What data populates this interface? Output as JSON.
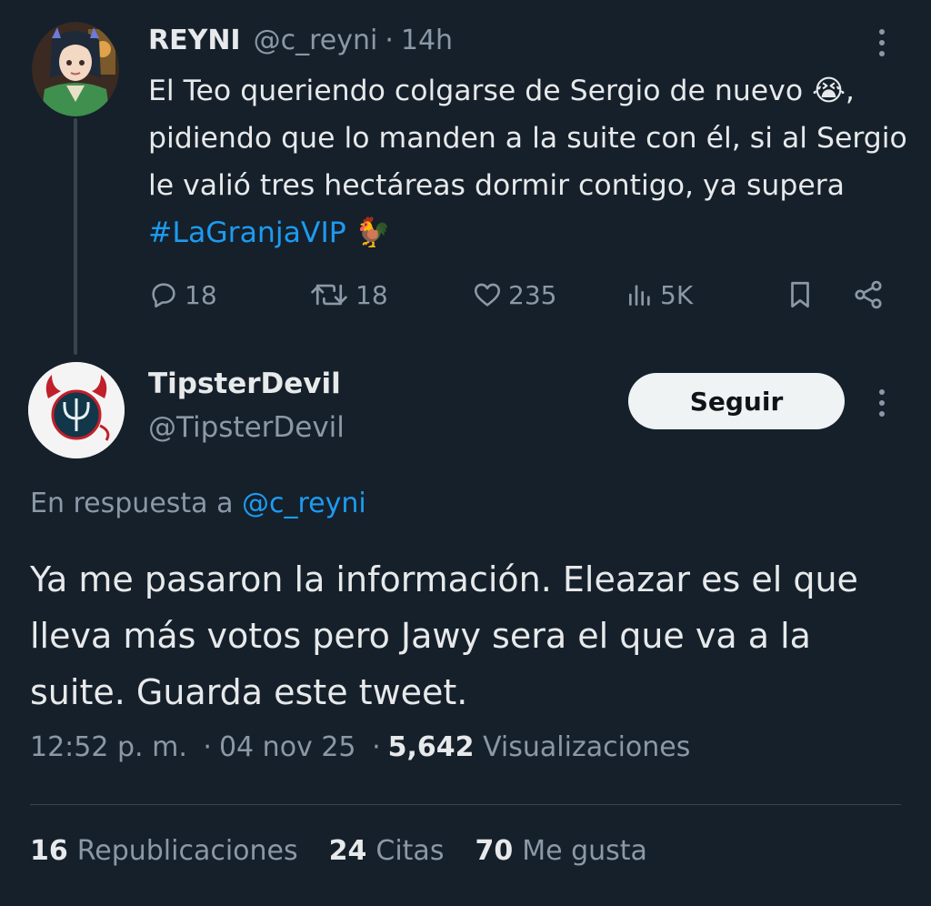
{
  "tweet1": {
    "display_name": "REYNI",
    "handle": "@c_reyni",
    "dot": "·",
    "time": "14h",
    "text_part1": "El Teo queriendo colgarse de Sergio de nuevo",
    "emoji1": "😭",
    "text_part2": ", pidiendo que lo manden a la suite con él, si al Sergio le valió tres hectáreas dormir contigo, ya supera ",
    "hashtag": "#LaGranjaVIP",
    "emoji2": "🐓",
    "replies": "18",
    "retweets": "18",
    "likes": "235",
    "views": "5K"
  },
  "tweet2": {
    "display_name": "TipsterDevil",
    "handle": "@TipsterDevil",
    "follow_label": "Seguir",
    "reply_to_prefix": "En respuesta a ",
    "reply_to_handle": "@c_reyni",
    "text": "Ya me pasaron la información. Eleazar es el que lleva más votos pero Jawy sera el que va a la suite. Guarda este tweet.",
    "time": "12:52 p. m.",
    "dot": "·",
    "date": "04 nov 25",
    "view_count": "5,642",
    "view_label": "Visualizaciones",
    "republications_count": "16",
    "republications_label": "Republicaciones",
    "quotes_count": "24",
    "quotes_label": "Citas",
    "likes_count": "70",
    "likes_label": "Me gusta"
  },
  "colors": {
    "background": "#15202b",
    "text": "#e7e9ea",
    "muted": "#8b98a5",
    "link": "#1d9bf0",
    "follow_button_bg": "#eff3f4"
  }
}
